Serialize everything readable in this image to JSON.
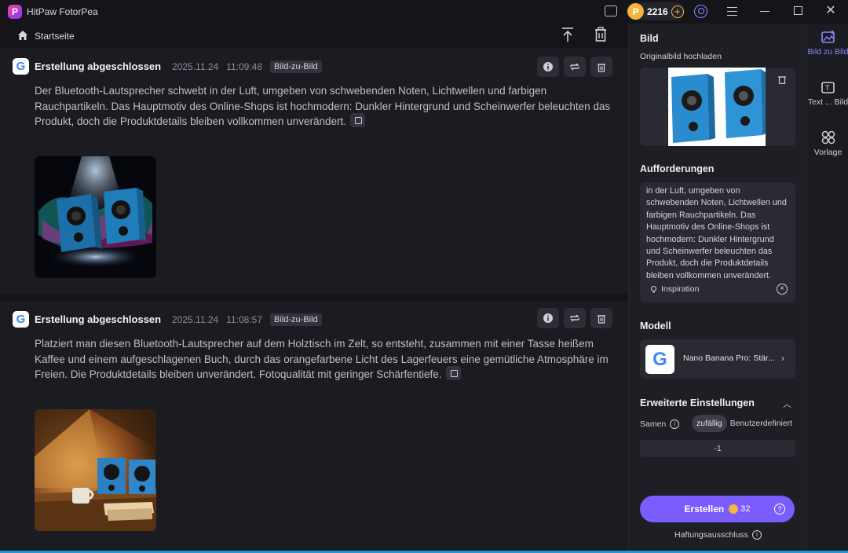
{
  "app": {
    "title": "HitPaw FotorPea"
  },
  "titlebar": {
    "coins": "2216",
    "coin_plus": "+",
    "close": "✕"
  },
  "header": {
    "home_label": "Startseite"
  },
  "feed": {
    "items": [
      {
        "status": "Erstellung abgeschlossen",
        "date": "2025.11.24",
        "time": "11:09:48",
        "badge": "Bild-zu-Bild",
        "text": "Der Bluetooth-Lautsprecher schwebt in der Luft, umgeben von schwebenden Noten, Lichtwellen und farbigen Rauchpartikeln. Das Hauptmotiv des Online-Shops ist hochmodern: Dunkler Hintergrund und Scheinwerfer beleuchten das Produkt, doch die Produktdetails bleiben vollkommen unverändert."
      },
      {
        "status": "Erstellung abgeschlossen",
        "date": "2025.11.24",
        "time": "11:08:57",
        "badge": "Bild-zu-Bild",
        "text": "Platziert man diesen Bluetooth-Lautsprecher auf dem Holztisch im Zelt, so entsteht, zusammen mit einer Tasse heißem Kaffee und einem aufgeschlagenen Buch, durch das orangefarbene Licht des Lagerfeuers eine gemütliche Atmosphäre im Freien. Die Produktdetails bleiben unverändert. Fotoqualität mit geringer Schärfentiefe."
      }
    ]
  },
  "panel": {
    "image_heading": "Bild",
    "upload_label": "Originalbild hochladen",
    "prompts_heading": "Aufforderungen",
    "prompt_text": "in der Luft, umgeben von schwebenden Noten, Lichtwellen und farbigen Rauchpartikeln. Das Hauptmotiv des Online-Shops ist hochmodern: Dunkler Hintergrund und Scheinwerfer beleuchten das Produkt, doch die Produktdetails bleiben vollkommen unverändert.",
    "inspiration_label": "Inspiration",
    "model_heading": "Modell",
    "model_name": "Nano Banana Pro: Stär...",
    "advanced_heading": "Erweiterte Einstellungen",
    "seed_label": "Samen",
    "seed_random": "zufällig",
    "seed_custom": "Benutzerdefiniert",
    "seed_value": "-1",
    "create_label": "Erstellen",
    "create_cost": "32",
    "disclaimer": "Haftungsausschluss"
  },
  "rnav": {
    "items": [
      {
        "label": "Bild zu Bild"
      },
      {
        "label": "Text ... Bild"
      },
      {
        "label": "Vorlage"
      }
    ]
  },
  "colors": {
    "accent": "#7a5cff",
    "coin": "#f5b53a",
    "active_nav": "#8f86ff"
  }
}
